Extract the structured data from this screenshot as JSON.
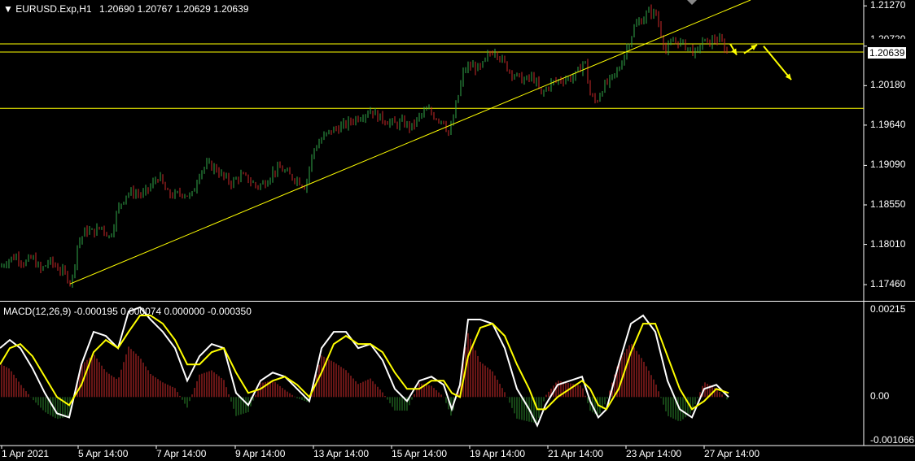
{
  "header": {
    "symbol": "EURUSD.Exp,H1",
    "ohlc": "1.20690 1.20767 1.20629 1.20639"
  },
  "macd_header": "MACD(12,26,9) -0.000195 0.000074 0.000000 -0.000350",
  "current_price": "1.20639",
  "colors": {
    "background": "#000000",
    "axis": "#ffffff",
    "bull": "#32a84a",
    "bear": "#cc2a2a",
    "trendline": "#ffff00",
    "macd_main": "#ffffff",
    "macd_signal": "#ffff00",
    "hist_pos": "#8b1e1e",
    "hist_neg": "#1e5a1e",
    "arrows": "#ffff00"
  },
  "chart_data": [
    {
      "type": "candlestick",
      "title": "EURUSD.Exp,H1",
      "ylim": [
        1.1725,
        1.2135
      ],
      "yticks": [
        "1.21270",
        "1.20720",
        "1.20180",
        "1.19640",
        "1.19090",
        "1.18550",
        "1.18010",
        "1.17460"
      ],
      "x_tick_labels": [
        "1 Apr 2021",
        "5 Apr 14:00",
        "7 Apr 14:00",
        "9 Apr 14:00",
        "13 Apr 14:00",
        "15 Apr 14:00",
        "19 Apr 14:00",
        "21 Apr 14:00",
        "23 Apr 14:00",
        "27 Apr 14:00"
      ],
      "close_path": [
        [
          0,
          1.177
        ],
        [
          10,
          1.178
        ],
        [
          20,
          1.1785
        ],
        [
          30,
          1.1775
        ],
        [
          40,
          1.1783
        ],
        [
          50,
          1.1765
        ],
        [
          60,
          1.1778
        ],
        [
          70,
          1.177
        ],
        [
          80,
          1.176
        ],
        [
          88,
          1.1748
        ],
        [
          95,
          1.18
        ],
        [
          105,
          1.182
        ],
        [
          115,
          1.1818
        ],
        [
          125,
          1.1825
        ],
        [
          135,
          1.181
        ],
        [
          145,
          1.185
        ],
        [
          155,
          1.187
        ],
        [
          165,
          1.1872
        ],
        [
          175,
          1.1868
        ],
        [
          185,
          1.188
        ],
        [
          195,
          1.1895
        ],
        [
          205,
          1.187
        ],
        [
          215,
          1.1868
        ],
        [
          225,
          1.1872
        ],
        [
          235,
          1.1865
        ],
        [
          245,
          1.19
        ],
        [
          255,
          1.191
        ],
        [
          265,
          1.1905
        ],
        [
          275,
          1.1892
        ],
        [
          285,
          1.1885
        ],
        [
          295,
          1.1895
        ],
        [
          305,
          1.189
        ],
        [
          315,
          1.188
        ],
        [
          325,
          1.1885
        ],
        [
          335,
          1.19
        ],
        [
          345,
          1.1905
        ],
        [
          355,
          1.1895
        ],
        [
          365,
          1.189
        ],
        [
          375,
          1.188
        ],
        [
          385,
          1.193
        ],
        [
          395,
          1.1945
        ],
        [
          405,
          1.1955
        ],
        [
          415,
          1.196
        ],
        [
          425,
          1.1965
        ],
        [
          435,
          1.1972
        ],
        [
          445,
          1.1978
        ],
        [
          455,
          1.1985
        ],
        [
          465,
          1.1975
        ],
        [
          475,
          1.197
        ],
        [
          485,
          1.1965
        ],
        [
          495,
          1.1968
        ],
        [
          505,
          1.196
        ],
        [
          515,
          1.1975
        ],
        [
          525,
          1.1985
        ],
        [
          535,
          1.1975
        ],
        [
          545,
          1.197
        ],
        [
          552,
          1.195
        ],
        [
          560,
          1.199
        ],
        [
          570,
          1.204
        ],
        [
          580,
          1.2045
        ],
        [
          590,
          1.204
        ],
        [
          600,
          1.206
        ],
        [
          608,
          1.2068
        ],
        [
          615,
          1.2055
        ],
        [
          625,
          1.204
        ],
        [
          635,
          1.203
        ],
        [
          645,
          1.2025
        ],
        [
          655,
          1.203
        ],
        [
          665,
          1.2005
        ],
        [
          675,
          1.202
        ],
        [
          685,
          1.2025
        ],
        [
          695,
          1.2028
        ],
        [
          705,
          1.203
        ],
        [
          712,
          1.204
        ],
        [
          718,
          1.2055
        ],
        [
          725,
          1.2005
        ],
        [
          732,
          1.1995
        ],
        [
          740,
          1.2015
        ],
        [
          750,
          1.2025
        ],
        [
          760,
          1.204
        ],
        [
          770,
          1.207
        ],
        [
          780,
          1.21
        ],
        [
          790,
          1.211
        ],
        [
          798,
          1.212
        ],
        [
          806,
          1.2115
        ],
        [
          812,
          1.209
        ],
        [
          818,
          1.2065
        ],
        [
          828,
          1.208
        ],
        [
          838,
          1.2075
        ],
        [
          848,
          1.2068
        ],
        [
          856,
          1.206
        ],
        [
          862,
          1.208
        ],
        [
          870,
          1.2075
        ],
        [
          878,
          1.2082
        ],
        [
          886,
          1.2078
        ],
        [
          893,
          1.2064
        ]
      ],
      "trendline": [
        [
          86,
          1.1747
        ],
        [
          922,
          1.2135
        ]
      ],
      "horizontal_lines": [
        1.2075,
        1.20639,
        1.1987
      ],
      "arrows": [
        [
          [
            897,
            1.2075
          ],
          [
            905,
            1.206
          ]
        ],
        [
          [
            914,
            1.2062
          ],
          [
            930,
            1.2074
          ]
        ],
        [
          [
            938,
            1.2072
          ],
          [
            972,
            1.2026
          ]
        ]
      ]
    },
    {
      "type": "line",
      "title": "MACD(12,26,9)",
      "ylim": [
        -0.00117,
        0.00232
      ],
      "yticks": [
        "0.00215",
        "0.00",
        "-0.001066"
      ],
      "series": [
        {
          "name": "main",
          "x": [
            0,
            12,
            25,
            40,
            55,
            70,
            85,
            100,
            115,
            130,
            145,
            158,
            172,
            185,
            200,
            215,
            230,
            245,
            260,
            275,
            290,
            305,
            320,
            335,
            350,
            365,
            380,
            395,
            410,
            425,
            440,
            455,
            470,
            485,
            500,
            515,
            530,
            545,
            555,
            565,
            575,
            590,
            605,
            620,
            635,
            650,
            660,
            670,
            685,
            700,
            715,
            725,
            735,
            745,
            760,
            775,
            790,
            805,
            820,
            835,
            850,
            865,
            880,
            895
          ],
          "y": [
            0.0012,
            0.0014,
            0.0012,
            0.0007,
            0.0001,
            -0.0004,
            -0.0005,
            0.0008,
            0.0016,
            0.0015,
            0.0012,
            0.0021,
            0.0022,
            0.0019,
            0.0016,
            0.0012,
            0.0004,
            0.001,
            0.0013,
            0.0012,
            0.0001,
            -0.0002,
            0.0004,
            0.0006,
            0.0005,
            0.0002,
            -0.0001,
            0.0012,
            0.0016,
            0.0016,
            0.0012,
            0.0013,
            0.0009,
            0.0002,
            -0.0001,
            0.0004,
            0.0005,
            0.0003,
            -0.0003,
            0.0003,
            0.0019,
            0.0019,
            0.0018,
            0.0012,
            0.0002,
            -0.0003,
            -0.0007,
            -0.0002,
            0.0003,
            0.0004,
            0.0005,
            -0.0001,
            -0.0005,
            -0.0003,
            0.0008,
            0.0018,
            0.002,
            0.0016,
            0.0004,
            -0.0003,
            -0.0005,
            0.0002,
            0.0003,
            0.0
          ]
        },
        {
          "name": "signal",
          "x": [
            0,
            12,
            25,
            40,
            55,
            70,
            85,
            100,
            115,
            130,
            145,
            158,
            172,
            185,
            200,
            215,
            230,
            245,
            260,
            275,
            290,
            305,
            320,
            335,
            350,
            365,
            380,
            395,
            410,
            425,
            440,
            455,
            470,
            485,
            500,
            515,
            530,
            545,
            555,
            565,
            575,
            590,
            605,
            620,
            635,
            650,
            660,
            670,
            685,
            700,
            715,
            725,
            735,
            745,
            760,
            775,
            790,
            805,
            820,
            835,
            850,
            865,
            880,
            895
          ],
          "y": [
            0.0008,
            0.0012,
            0.0013,
            0.001,
            0.0005,
            0.0,
            -0.0002,
            0.0003,
            0.0011,
            0.0014,
            0.0012,
            0.0016,
            0.002,
            0.002,
            0.0018,
            0.0014,
            0.0008,
            0.0008,
            0.0011,
            0.0012,
            0.0006,
            0.0001,
            0.0002,
            0.0004,
            0.0005,
            0.0003,
            0.0,
            0.0006,
            0.0013,
            0.0015,
            0.0013,
            0.0013,
            0.0011,
            0.0006,
            0.0002,
            0.0002,
            0.0004,
            0.0004,
            0.0001,
            0.0,
            0.001,
            0.0017,
            0.0018,
            0.0015,
            0.0008,
            0.0002,
            -0.0003,
            -0.0003,
            0.0,
            0.0002,
            0.0004,
            0.0002,
            -0.0002,
            -0.0003,
            0.0002,
            0.0011,
            0.0018,
            0.0018,
            0.001,
            0.0002,
            -0.0003,
            -0.0001,
            0.0002,
            0.0001
          ]
        }
      ]
    }
  ]
}
